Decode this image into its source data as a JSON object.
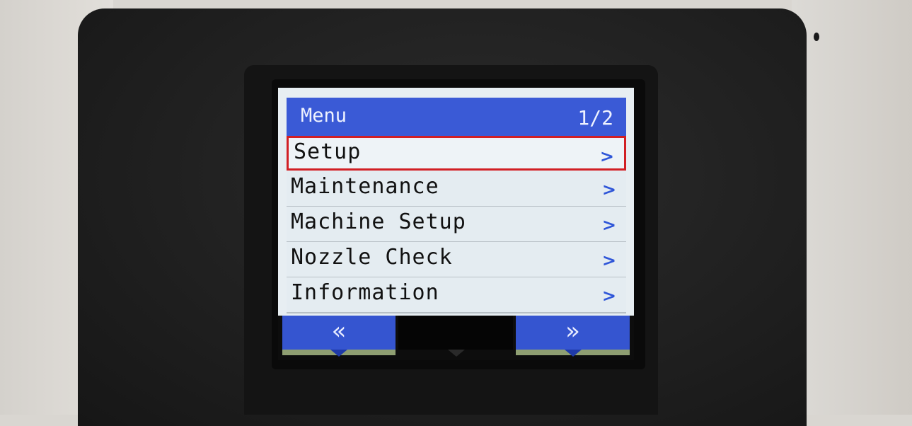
{
  "menu": {
    "title": "Menu",
    "page": "1/2",
    "items": [
      {
        "label": "Setup",
        "selected": true
      },
      {
        "label": "Maintenance",
        "selected": false
      },
      {
        "label": "Machine Setup",
        "selected": false
      },
      {
        "label": "Nozzle Check",
        "selected": false
      },
      {
        "label": "Information",
        "selected": false
      }
    ],
    "chevron": ">"
  },
  "footer": {
    "prev_glyph": "«",
    "middle_label": "",
    "next_glyph": "»"
  },
  "colors": {
    "header_blue": "#3a5ad6",
    "selection_red": "#d11f24",
    "row_bg": "#e4ecf1",
    "chevron_blue": "#2f56d8"
  }
}
